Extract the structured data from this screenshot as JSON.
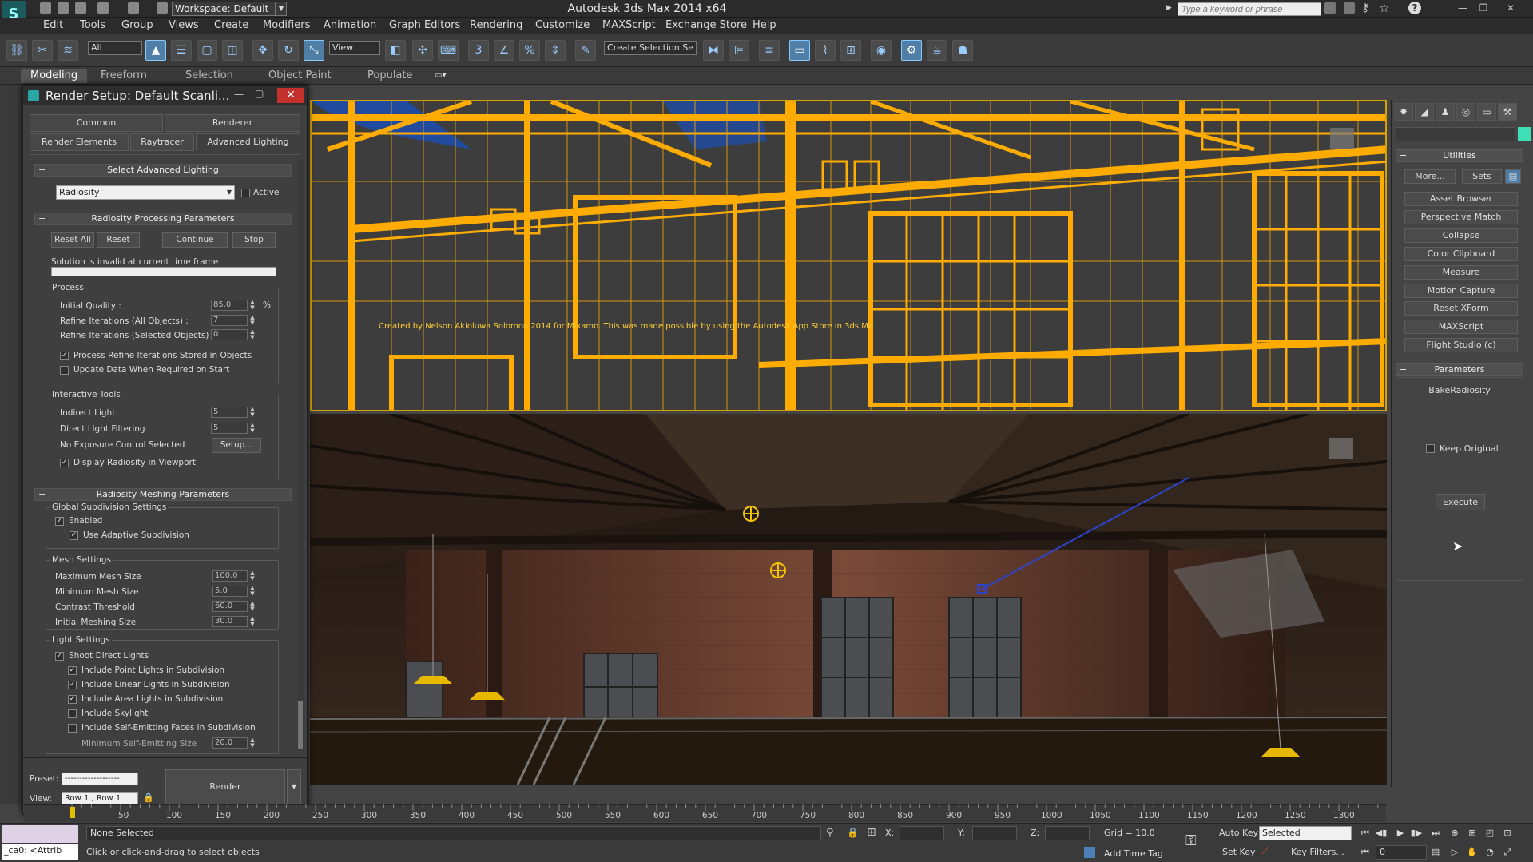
{
  "titlebar": {
    "workspace": "Workspace: Default",
    "title": "Autodesk 3ds Max  2014 x64",
    "search_placeholder": "Type a keyword or phrase"
  },
  "menu": [
    "Edit",
    "Tools",
    "Group",
    "Views",
    "Create",
    "Modifiers",
    "Animation",
    "Graph Editors",
    "Rendering",
    "Customize",
    "MAXScript",
    "Exchange Store",
    "Help"
  ],
  "toolbar": {
    "selection_filter": "All",
    "reference_coord": "View",
    "named_selection": "Create Selection Se"
  },
  "ribbon": {
    "tabs": [
      "Modeling",
      "Freeform",
      "Selection",
      "Object Paint",
      "Populate"
    ],
    "active": "Modeling"
  },
  "render_setup": {
    "title": "Render Setup: Default Scanli...",
    "tabs_row1": [
      "Common",
      "Renderer"
    ],
    "tabs_row2": [
      "Render Elements",
      "Raytracer",
      "Advanced Lighting"
    ],
    "select_adv_lighting": {
      "header": "Select Advanced Lighting",
      "dropdown": "Radiosity",
      "active_label": "Active"
    },
    "processing": {
      "header": "Radiosity Processing Parameters",
      "buttons": [
        "Reset All",
        "Reset",
        "Continue",
        "Stop"
      ],
      "status": "Solution is invalid at current time frame",
      "process_group": "Process",
      "initial_quality_label": "Initial Quality :",
      "initial_quality_value": "85.0",
      "percent": "%",
      "refine_all_label": "Refine Iterations (All Objects) :",
      "refine_all_value": "7",
      "refine_sel_label": "Refine Iterations (Selected Objects) :",
      "refine_sel_value": "0",
      "process_refine": "Process Refine Iterations Stored in Objects",
      "update_data": "Update Data When Required on Start",
      "interactive_group": "Interactive Tools",
      "indirect_light_label": "Indirect Light",
      "indirect_light_value": "5",
      "direct_filter_label": "Direct Light Filtering",
      "direct_filter_value": "5",
      "exposure_label": "No Exposure Control Selected",
      "setup_button": "Setup...",
      "display_radiosity": "Display Radiosity in Viewport"
    },
    "meshing": {
      "header": "Radiosity Meshing Parameters",
      "global_group": "Global Subdivision Settings",
      "enabled": "Enabled",
      "adaptive": "Use Adaptive Subdivision",
      "mesh_group": "Mesh Settings",
      "max_mesh_label": "Maximum Mesh Size",
      "max_mesh_value": "100.0",
      "min_mesh_label": "Minimum Mesh Size",
      "min_mesh_value": "5.0",
      "contrast_label": "Contrast Threshold",
      "contrast_value": "60.0",
      "initial_mesh_label": "Initial Meshing Size",
      "initial_mesh_value": "30.0",
      "light_group": "Light Settings",
      "shoot_direct": "Shoot Direct Lights",
      "point_lights": "Include Point Lights in Subdivision",
      "linear_lights": "Include Linear Lights in Subdivision",
      "area_lights": "Include Area Lights in Subdivision",
      "skylight": "Include Skylight",
      "self_emitting": "Include Self-Emitting Faces in Subdivision",
      "min_self_label": "Minimum Self-Emitting Size",
      "min_self_value": "20.0"
    },
    "footer": {
      "preset_label": "Preset:",
      "preset_value": "-------------------",
      "view_label": "View:",
      "view_value": "Row 1 , Row 1",
      "render_button": "Render"
    }
  },
  "viewport": {
    "top_caption": "Created by Nelson Akioluwa Solomon 2014 for Mixamo. This was made possible by using the Autodesk App Store in 3ds Max powered by Mixamo."
  },
  "command_panel": {
    "utilities_header": "Utilities",
    "more_button": "More...",
    "sets_button": "Sets",
    "buttons": [
      "Asset Browser",
      "Perspective Match",
      "Collapse",
      "Color Clipboard",
      "Measure",
      "Motion Capture",
      "Reset XForm",
      "MAXScript",
      "Flight Studio (c)"
    ],
    "parameters_header": "Parameters",
    "script_name": "BakeRadiosity",
    "keep_original": "Keep Original",
    "execute_button": "Execute"
  },
  "timeline": {
    "ticks": [
      "50",
      "100",
      "150",
      "200",
      "250",
      "300",
      "350",
      "400",
      "450",
      "500",
      "550",
      "600",
      "650",
      "700",
      "750",
      "800",
      "850",
      "900",
      "950",
      "1000",
      "1050",
      "1100",
      "1150",
      "1200",
      "1250",
      "1300"
    ]
  },
  "status": {
    "listener": "_ca0: <Attrib",
    "selection": "None Selected",
    "prompt": "Click or click-and-drag to select objects",
    "x_label": "X:",
    "y_label": "Y:",
    "z_label": "Z:",
    "grid": "Grid = 10.0",
    "add_time_tag": "Add Time Tag",
    "auto_key": "Auto Key",
    "set_key": "Set Key",
    "key_mode": "Selected",
    "key_filters": "Key Filters...",
    "frame": "0"
  }
}
